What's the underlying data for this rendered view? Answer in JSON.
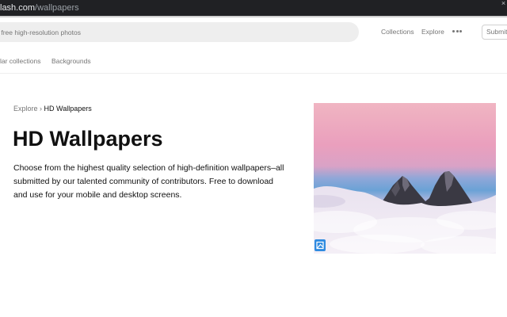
{
  "browser": {
    "url_host": "lash.com",
    "url_path": "/wallpapers",
    "close_glyph": "×"
  },
  "header": {
    "search_placeholder": "ch free high-resolution photos",
    "nav": {
      "collections": "Collections",
      "explore": "Explore",
      "more_icon": "more-horizontal-icon"
    },
    "submit_label": "Submit",
    "topics": {
      "popular_collections": "lar collections",
      "backgrounds": "Backgrounds"
    }
  },
  "main": {
    "breadcrumb": {
      "explore": "Explore",
      "separator": "›",
      "current": "HD Wallpapers"
    },
    "title": "HD Wallpapers",
    "description": "Choose from the highest quality selection of high-definition wallpapers–all submitted by our talented community of contributors. Free to download and use for your mobile and desktop screens."
  },
  "hero": {
    "subject_icon": "image-icon",
    "badge_icon": "image-link-icon",
    "colors": {
      "sky_top": "#efb3c1",
      "sky_mid": "#e8a2bd",
      "sky_band": "#6fa3d6",
      "clouds": "#f1ebf3",
      "mountains": "#3d3c45"
    }
  },
  "colors": {
    "text_primary": "#111111",
    "text_secondary": "#767676",
    "search_bg": "#eeeeee",
    "browser_bar": "#202124"
  }
}
